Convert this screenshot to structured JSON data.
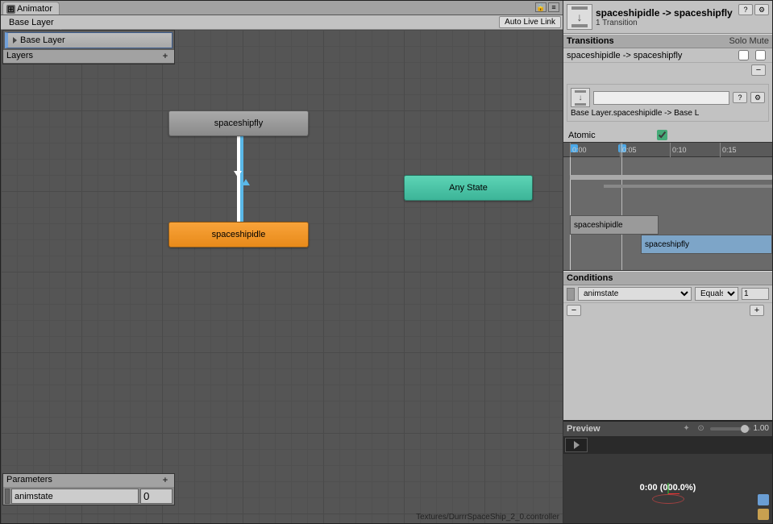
{
  "animator": {
    "tab_label": "Animator",
    "breadcrumb": "Base Layer",
    "auto_live_link": "Auto Live Link",
    "layers_header": "Layers",
    "layer_items": [
      {
        "name": "Base Layer"
      }
    ],
    "parameters_header": "Parameters",
    "parameters": [
      {
        "name": "animstate",
        "value": "0"
      }
    ],
    "footer_path": "Textures/DurrrSpaceShip_2_0.controller"
  },
  "graph": {
    "nodes": {
      "fly": "spaceshipfly",
      "idle": "spaceshipidle",
      "anystate": "Any State"
    }
  },
  "inspector": {
    "title": "spaceshipidle -> spaceshipfly",
    "subtitle": "1 Transition",
    "transitions_header": "Transitions",
    "solo_label": "Solo",
    "mute_label": "Mute",
    "transition_row": "spaceshipidle -> spaceshipfly",
    "name_path": "Base Layer.spaceshipidle -> Base L",
    "atomic_label": "Atomic",
    "atomic_checked": true,
    "timeline": {
      "ticks": [
        "0:00",
        "0:05",
        "0:10",
        "0:15"
      ],
      "clip_idle": "spaceshipidle",
      "clip_fly": "spaceshipfly"
    },
    "conditions": {
      "header": "Conditions",
      "param": "animstate",
      "operator": "Equals",
      "value": "1"
    }
  },
  "preview": {
    "header": "Preview",
    "speed": "1.00",
    "time_label": "0:00 (000.0%)"
  }
}
